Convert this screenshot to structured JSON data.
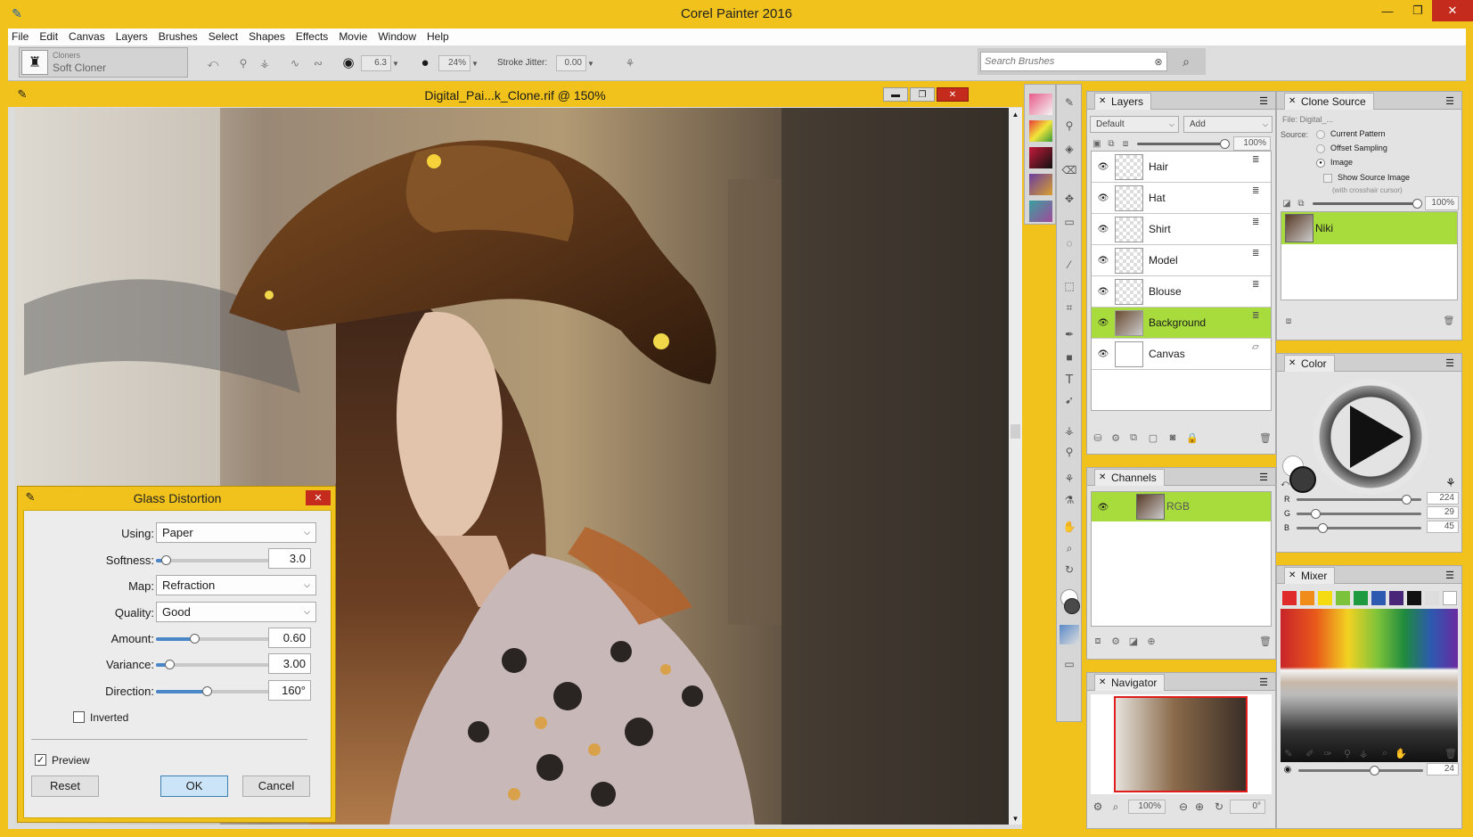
{
  "app": {
    "title": "Corel Painter 2016"
  },
  "menu": [
    "File",
    "Edit",
    "Canvas",
    "Layers",
    "Brushes",
    "Select",
    "Shapes",
    "Effects",
    "Movie",
    "Window",
    "Help"
  ],
  "brush": {
    "category": "Cloners",
    "variant": "Soft Cloner",
    "size": "6.3",
    "opacity": "24%",
    "stroke_jitter_label": "Stroke Jitter:",
    "stroke_jitter": "0.00",
    "search_placeholder": "Search Brushes"
  },
  "document": {
    "title": "Digital_Pai...k_Clone.rif @ 150%"
  },
  "dialog": {
    "title": "Glass Distortion",
    "using_label": "Using:",
    "using": "Paper",
    "softness_label": "Softness:",
    "softness": "3.0",
    "map_label": "Map:",
    "map": "Refraction",
    "quality_label": "Quality:",
    "quality": "Good",
    "amount_label": "Amount:",
    "amount": "0.60",
    "variance_label": "Variance:",
    "variance": "3.00",
    "direction_label": "Direction:",
    "direction": "160°",
    "inverted_label": "Inverted",
    "preview_label": "Preview",
    "reset": "Reset",
    "ok": "OK",
    "cancel": "Cancel",
    "softness_level": 0.05,
    "amount_level": 0.33,
    "variance_level": 0.1,
    "direction_level": 0.44
  },
  "layers": {
    "tab": "Layers",
    "composite": "Default",
    "method": "Add",
    "opacity": "100%",
    "items": [
      {
        "name": "Hair"
      },
      {
        "name": "Hat"
      },
      {
        "name": "Shirt"
      },
      {
        "name": "Model"
      },
      {
        "name": "Blouse"
      },
      {
        "name": "Background",
        "selected": true
      },
      {
        "name": "Canvas"
      }
    ]
  },
  "channels": {
    "tab": "Channels",
    "item": "RGB"
  },
  "navigator": {
    "tab": "Navigator",
    "zoom": "100%",
    "angle": "0°"
  },
  "clone_source": {
    "tab": "Clone Source",
    "file_label": "File: Digital_...",
    "source_label": "Source:",
    "options": [
      "Current Pattern",
      "Offset Sampling",
      "Image"
    ],
    "show_source_label": "Show Source Image",
    "crosshair_note": "(with crosshair cursor)",
    "opacity": "100%",
    "item": "Niki"
  },
  "color": {
    "tab": "Color",
    "r_label": "R",
    "g_label": "G",
    "b_label": "B",
    "r": "224",
    "g": "29",
    "b": "45"
  },
  "mixer": {
    "tab": "Mixer",
    "size": "24",
    "swatches": [
      "#e02b2b",
      "#f08c1a",
      "#f5dc12",
      "#7cc23a",
      "#1f9a3f",
      "#2d59b0",
      "#4a2678",
      "#111111",
      "#dddddd",
      "#ffffff"
    ]
  }
}
